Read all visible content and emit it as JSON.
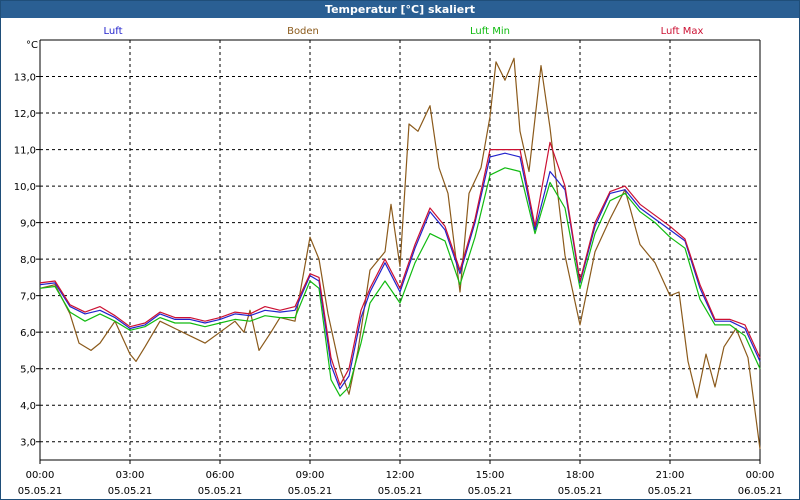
{
  "window": {
    "title": "Temperatur [°C] skaliert"
  },
  "colors": {
    "luft": "#2222cc",
    "boden": "#8b5a1b",
    "luft_min": "#11bb11",
    "luft_max": "#cc1133",
    "titlebar": "#2a5f93"
  },
  "chart_data": {
    "type": "line",
    "title": "Temperatur [°C] skaliert",
    "ylabel": "°C",
    "xlabel": "",
    "ylim": [
      2.5,
      14.0
    ],
    "xlim": [
      0,
      24
    ],
    "grid": true,
    "legend_position": "top",
    "yticks": [
      {
        "v": 3.0,
        "label": "3,0"
      },
      {
        "v": 4.0,
        "label": "4,0"
      },
      {
        "v": 5.0,
        "label": "5,0"
      },
      {
        "v": 6.0,
        "label": "6,0"
      },
      {
        "v": 7.0,
        "label": "7,0"
      },
      {
        "v": 8.0,
        "label": "8,0"
      },
      {
        "v": 9.0,
        "label": "9,0"
      },
      {
        "v": 10.0,
        "label": "10,0"
      },
      {
        "v": 11.0,
        "label": "11,0"
      },
      {
        "v": 12.0,
        "label": "12,0"
      },
      {
        "v": 13.0,
        "label": "13,0"
      }
    ],
    "xticks": [
      {
        "v": 0,
        "time": "00:00",
        "date": "05.05.21"
      },
      {
        "v": 3,
        "time": "03:00",
        "date": "05.05.21"
      },
      {
        "v": 6,
        "time": "06:00",
        "date": "05.05.21"
      },
      {
        "v": 9,
        "time": "09:00",
        "date": "05.05.21"
      },
      {
        "v": 12,
        "time": "12:00",
        "date": "05.05.21"
      },
      {
        "v": 15,
        "time": "15:00",
        "date": "05.05.21"
      },
      {
        "v": 18,
        "time": "18:00",
        "date": "05.05.21"
      },
      {
        "v": 21,
        "time": "21:00",
        "date": "05.05.21"
      },
      {
        "v": 24,
        "time": "00:00",
        "date": "06.05.21"
      }
    ],
    "series": [
      {
        "name": "Luft",
        "color": "#2222cc",
        "points": [
          [
            0,
            7.3
          ],
          [
            0.5,
            7.35
          ],
          [
            1,
            6.7
          ],
          [
            1.5,
            6.5
          ],
          [
            2,
            6.6
          ],
          [
            2.5,
            6.4
          ],
          [
            3,
            6.1
          ],
          [
            3.5,
            6.2
          ],
          [
            4,
            6.5
          ],
          [
            4.5,
            6.35
          ],
          [
            5,
            6.35
          ],
          [
            5.5,
            6.25
          ],
          [
            6,
            6.35
          ],
          [
            6.5,
            6.5
          ],
          [
            7,
            6.45
          ],
          [
            7.5,
            6.6
          ],
          [
            8,
            6.55
          ],
          [
            8.5,
            6.6
          ],
          [
            9,
            7.55
          ],
          [
            9.3,
            7.4
          ],
          [
            9.7,
            5.1
          ],
          [
            10,
            4.45
          ],
          [
            10.3,
            4.8
          ],
          [
            10.7,
            6.4
          ],
          [
            11,
            7.1
          ],
          [
            11.5,
            7.9
          ],
          [
            12,
            7.1
          ],
          [
            12.5,
            8.3
          ],
          [
            13,
            9.3
          ],
          [
            13.5,
            8.8
          ],
          [
            14,
            7.6
          ],
          [
            14.5,
            9.0
          ],
          [
            15,
            10.8
          ],
          [
            15.5,
            10.9
          ],
          [
            16,
            10.8
          ],
          [
            16.5,
            8.8
          ],
          [
            17,
            10.4
          ],
          [
            17.5,
            9.9
          ],
          [
            18,
            7.35
          ],
          [
            18.5,
            8.9
          ],
          [
            19,
            9.8
          ],
          [
            19.5,
            9.9
          ],
          [
            20,
            9.4
          ],
          [
            20.5,
            9.1
          ],
          [
            21,
            8.8
          ],
          [
            21.5,
            8.5
          ],
          [
            22,
            7.2
          ],
          [
            22.5,
            6.3
          ],
          [
            23,
            6.3
          ],
          [
            23.5,
            6.1
          ],
          [
            24,
            5.2
          ]
        ]
      },
      {
        "name": "Boden",
        "color": "#8b5a1b",
        "points": [
          [
            0,
            7.2
          ],
          [
            0.5,
            7.3
          ],
          [
            1,
            6.5
          ],
          [
            1.3,
            5.7
          ],
          [
            1.7,
            5.5
          ],
          [
            2,
            5.7
          ],
          [
            2.5,
            6.3
          ],
          [
            3,
            5.4
          ],
          [
            3.2,
            5.2
          ],
          [
            3.5,
            5.6
          ],
          [
            4,
            6.3
          ],
          [
            4.5,
            6.1
          ],
          [
            5,
            5.9
          ],
          [
            5.5,
            5.7
          ],
          [
            6,
            6.0
          ],
          [
            6.5,
            6.3
          ],
          [
            6.8,
            6.0
          ],
          [
            7,
            6.6
          ],
          [
            7.3,
            5.5
          ],
          [
            7.7,
            6.0
          ],
          [
            8,
            6.4
          ],
          [
            8.5,
            6.3
          ],
          [
            9,
            8.6
          ],
          [
            9.3,
            8.0
          ],
          [
            9.6,
            6.5
          ],
          [
            10,
            5.0
          ],
          [
            10.3,
            4.3
          ],
          [
            10.6,
            5.5
          ],
          [
            11,
            7.7
          ],
          [
            11.5,
            8.2
          ],
          [
            11.7,
            9.5
          ],
          [
            12,
            7.8
          ],
          [
            12.3,
            11.7
          ],
          [
            12.6,
            11.5
          ],
          [
            13,
            12.2
          ],
          [
            13.3,
            10.5
          ],
          [
            13.6,
            9.8
          ],
          [
            14,
            7.1
          ],
          [
            14.3,
            9.8
          ],
          [
            14.7,
            10.5
          ],
          [
            15,
            11.9
          ],
          [
            15.2,
            13.4
          ],
          [
            15.5,
            12.9
          ],
          [
            15.8,
            13.5
          ],
          [
            16,
            11.5
          ],
          [
            16.3,
            10.4
          ],
          [
            16.7,
            13.3
          ],
          [
            17,
            11.6
          ],
          [
            17.5,
            8.1
          ],
          [
            18,
            6.2
          ],
          [
            18.5,
            8.2
          ],
          [
            19,
            9.1
          ],
          [
            19.5,
            9.9
          ],
          [
            20,
            8.4
          ],
          [
            20.5,
            7.9
          ],
          [
            21,
            7.0
          ],
          [
            21.3,
            7.1
          ],
          [
            21.6,
            5.2
          ],
          [
            21.9,
            4.2
          ],
          [
            22.2,
            5.4
          ],
          [
            22.5,
            4.5
          ],
          [
            22.8,
            5.6
          ],
          [
            23.2,
            6.1
          ],
          [
            23.6,
            5.3
          ],
          [
            24,
            2.8
          ]
        ]
      },
      {
        "name": "Luft Min",
        "color": "#11bb11",
        "points": [
          [
            0,
            7.2
          ],
          [
            0.5,
            7.25
          ],
          [
            1,
            6.55
          ],
          [
            1.5,
            6.3
          ],
          [
            2,
            6.5
          ],
          [
            2.5,
            6.3
          ],
          [
            3,
            6.05
          ],
          [
            3.5,
            6.15
          ],
          [
            4,
            6.4
          ],
          [
            4.5,
            6.25
          ],
          [
            5,
            6.25
          ],
          [
            5.5,
            6.15
          ],
          [
            6,
            6.25
          ],
          [
            6.5,
            6.35
          ],
          [
            7,
            6.3
          ],
          [
            7.5,
            6.45
          ],
          [
            8,
            6.4
          ],
          [
            8.5,
            6.4
          ],
          [
            9,
            7.4
          ],
          [
            9.3,
            7.2
          ],
          [
            9.7,
            4.7
          ],
          [
            10,
            4.25
          ],
          [
            10.3,
            4.5
          ],
          [
            10.7,
            5.7
          ],
          [
            11,
            6.8
          ],
          [
            11.5,
            7.4
          ],
          [
            12,
            6.8
          ],
          [
            12.5,
            7.9
          ],
          [
            13,
            8.7
          ],
          [
            13.5,
            8.5
          ],
          [
            14,
            7.3
          ],
          [
            14.5,
            8.6
          ],
          [
            15,
            10.3
          ],
          [
            15.5,
            10.5
          ],
          [
            16,
            10.4
          ],
          [
            16.5,
            8.7
          ],
          [
            17,
            10.1
          ],
          [
            17.5,
            9.4
          ],
          [
            18,
            7.2
          ],
          [
            18.5,
            8.7
          ],
          [
            19,
            9.6
          ],
          [
            19.5,
            9.8
          ],
          [
            20,
            9.3
          ],
          [
            20.5,
            9.0
          ],
          [
            21,
            8.6
          ],
          [
            21.5,
            8.3
          ],
          [
            22,
            6.9
          ],
          [
            22.5,
            6.2
          ],
          [
            23,
            6.2
          ],
          [
            23.5,
            5.9
          ],
          [
            24,
            5.0
          ]
        ]
      },
      {
        "name": "Luft Max",
        "color": "#cc1133",
        "points": [
          [
            0,
            7.35
          ],
          [
            0.5,
            7.4
          ],
          [
            1,
            6.75
          ],
          [
            1.5,
            6.55
          ],
          [
            2,
            6.7
          ],
          [
            2.5,
            6.45
          ],
          [
            3,
            6.15
          ],
          [
            3.5,
            6.25
          ],
          [
            4,
            6.55
          ],
          [
            4.5,
            6.4
          ],
          [
            5,
            6.4
          ],
          [
            5.5,
            6.3
          ],
          [
            6,
            6.4
          ],
          [
            6.5,
            6.55
          ],
          [
            7,
            6.5
          ],
          [
            7.5,
            6.7
          ],
          [
            8,
            6.6
          ],
          [
            8.5,
            6.7
          ],
          [
            9,
            7.6
          ],
          [
            9.3,
            7.5
          ],
          [
            9.7,
            5.3
          ],
          [
            10,
            4.55
          ],
          [
            10.3,
            5.0
          ],
          [
            10.7,
            6.6
          ],
          [
            11,
            7.2
          ],
          [
            11.5,
            8.0
          ],
          [
            12,
            7.2
          ],
          [
            12.5,
            8.4
          ],
          [
            13,
            9.4
          ],
          [
            13.5,
            8.9
          ],
          [
            14,
            7.7
          ],
          [
            14.5,
            9.1
          ],
          [
            15,
            11.0
          ],
          [
            15.5,
            11.0
          ],
          [
            16,
            11.0
          ],
          [
            16.5,
            8.9
          ],
          [
            17,
            11.2
          ],
          [
            17.5,
            10.0
          ],
          [
            18,
            7.4
          ],
          [
            18.5,
            9.0
          ],
          [
            19,
            9.85
          ],
          [
            19.5,
            10.0
          ],
          [
            20,
            9.5
          ],
          [
            20.5,
            9.2
          ],
          [
            21,
            8.9
          ],
          [
            21.5,
            8.55
          ],
          [
            22,
            7.3
          ],
          [
            22.5,
            6.35
          ],
          [
            23,
            6.35
          ],
          [
            23.5,
            6.2
          ],
          [
            24,
            5.3
          ]
        ]
      }
    ]
  }
}
